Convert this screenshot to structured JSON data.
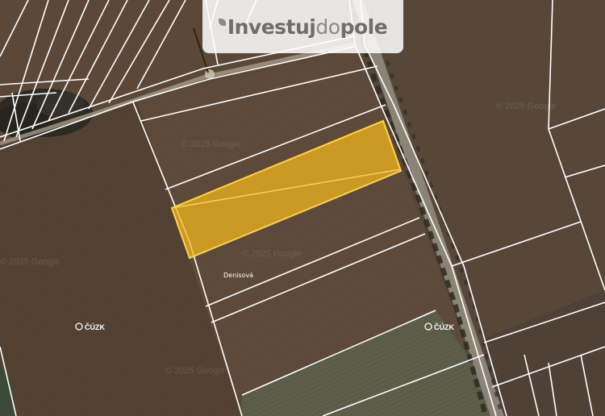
{
  "logo": {
    "part1": "Investuj",
    "part2": "do",
    "part3": "pole"
  },
  "map": {
    "parcel_label": "Denisová",
    "provider_label_left": "ČÚZK",
    "provider_label_right": "ČÚZK",
    "watermarks": [
      "© 2025 Google",
      "© 2025 Google",
      "© 2025 Google",
      "© 2025 Google",
      "© 2025 Google"
    ],
    "highlight_color": "#f5b81c",
    "highlight_border": "#ffd24a",
    "boundary_color": "#ffffff"
  }
}
